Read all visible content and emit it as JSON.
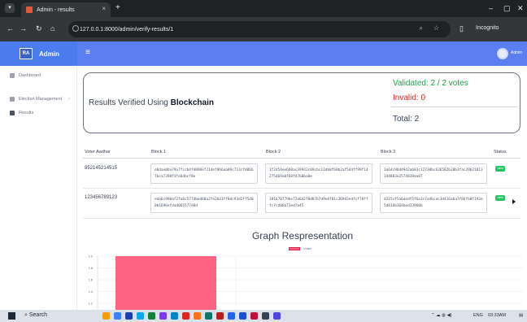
{
  "browser": {
    "tab_title": "Admin - results",
    "tab_close": "×",
    "new_tab": "+",
    "url": "127.0.0.1:8000/admin/verify-results/1",
    "profile_label": "Incognito"
  },
  "app": {
    "brand": "Admin",
    "logo_text": "RA",
    "user_name": "Admin"
  },
  "sidebar": {
    "items": [
      {
        "label": "Dashboard"
      },
      {
        "label": "Election Management"
      },
      {
        "label": "Results"
      }
    ]
  },
  "summary": {
    "title_prefix": "Results Verified Using ",
    "title_bold": "Blockchain",
    "validated": "Validated: 2 / 2 votes",
    "invalid": "Invalid: 0",
    "total": "Total: 2"
  },
  "table": {
    "headers": [
      "Voter Aadhar",
      "Block 1",
      "Block 2",
      "Block 3",
      "Status"
    ],
    "rows": [
      {
        "aadhar": "852145214515",
        "block1": "ebdae0ba79a7fccb4f4098ef21def9b6aa89c713cfd06b7bca7398f3fe64bcf8e",
        "block2": "1f2d54ee660ac39942c09cbc11db0f60b2af5d4ff99f14275469a0f60fd7b0ba8e",
        "block3": "1a6dc9bd49d2a603c12730bc636582b20b3fac29b21813344803e2574839aa07",
        "status": "Valid"
      },
      {
        "aadhar": "123456789123",
        "block1": "eda6c990af2fa6c5774bed60a2fe2643ff0dc93d2ff5d00b1696efdad065577d0d",
        "block2": "101b70779be72a642f0d87b7d9e0f01c369d3edfcf78fffc7cd86b73ed7a45",
        "block3": "d215cf5a6aedf5f6a3c7a4bcac3d416aba7f86fb8f193e5d816b364bed13960b",
        "status": "Valid"
      }
    ]
  },
  "graph": {
    "title": "Graph Respresentation"
  },
  "chart_data": {
    "type": "bar",
    "categories": [
      ""
    ],
    "series": [
      {
        "name": "Votes",
        "values": [
          2
        ]
      }
    ],
    "ylim": [
      1.2,
      2.0
    ],
    "yticks": [
      "2.0",
      "1.8",
      "1.6",
      "1.4",
      "1.2"
    ],
    "bar_color": "#ff6384"
  },
  "taskbar": {
    "search": "Search",
    "tray_lang": "ENG",
    "tray_time": "03:33AM"
  }
}
